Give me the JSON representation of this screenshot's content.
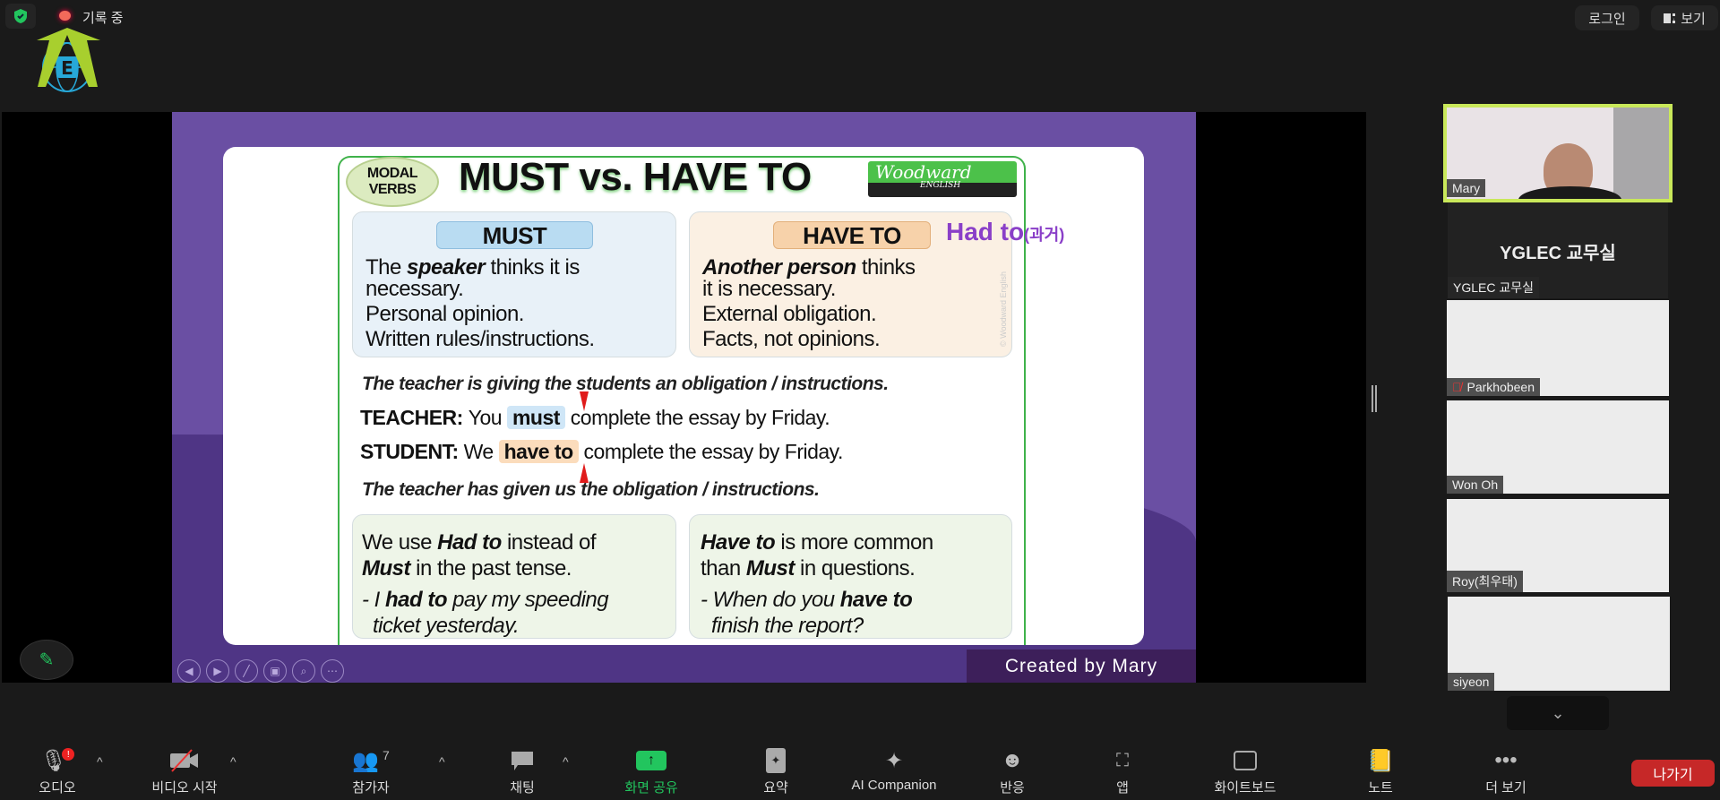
{
  "top": {
    "recording_label": "기록 중",
    "login_label": "로그인",
    "view_label": "보기"
  },
  "slide": {
    "badge": [
      "MODAL",
      "VERBS"
    ],
    "title": "MUST vs. HAVE TO",
    "logo": "Woodward ENGLISH",
    "must": {
      "label": "MUST",
      "lines": [
        [
          "The ",
          "speaker",
          " thinks it is"
        ],
        "necessary.",
        "Personal opinion.",
        "Written rules/instructions."
      ]
    },
    "have_to": {
      "label": "HAVE TO",
      "lines": [
        [
          "",
          "Another person",
          " thinks"
        ],
        "it is necessary.",
        "External obligation.",
        "Facts, not opinions."
      ]
    },
    "annotation": {
      "text": "Had to",
      "suffix": "(과거)",
      "color": "#8a3fc8"
    },
    "watermark": "© Woodward English",
    "sentence1": "The teacher is giving the students an obligation / instructions.",
    "teacher": {
      "speaker": "TEACHER:",
      "pre": "You",
      "verb": "must",
      "post": "complete the essay by Friday."
    },
    "student": {
      "speaker": "STUDENT:",
      "pre": "We",
      "verb": "have to",
      "post": "complete the essay by Friday."
    },
    "sentence2": "The teacher has given us the obligation / instructions.",
    "bottom_left": {
      "l1a": "We use ",
      "l1b": "Had to",
      "l1c": " instead of",
      "l2a": "Must",
      "l2b": " in the past tense.",
      "e1a": "- I ",
      "e1b": "had to",
      "e1c": " pay my speeding",
      "e2": "ticket yesterday."
    },
    "bottom_right": {
      "l1a": "Have to",
      "l1b": " is more common",
      "l2a": "than ",
      "l2b": "Must",
      "l2c": " in questions.",
      "e1a": "- When do you ",
      "e1b": "have to",
      "e2": "finish the report?"
    },
    "credit": "Created by Mary"
  },
  "participants": [
    {
      "name": "Mary",
      "video": true,
      "active_speaker": true
    },
    {
      "name": "YGLEC 교무실",
      "display": "YGLEC 교무실",
      "video": false
    },
    {
      "name": "Parkhobeen",
      "muted": true
    },
    {
      "name": "Won Oh"
    },
    {
      "name": "Roy(최우태)"
    },
    {
      "name": "siyeon"
    }
  ],
  "toolbar": {
    "audio": "오디오",
    "video": "비디오 시작",
    "participants": "참가자",
    "participant_count": "7",
    "chat": "채팅",
    "share": "화면 공유",
    "summary": "요약",
    "ai": "AI Companion",
    "reactions": "반응",
    "apps": "앱",
    "whiteboard": "화이트보드",
    "notes": "노트",
    "more": "더 보기",
    "leave": "나가기",
    "share_color": "#22c55e",
    "leave_color": "#c62828"
  }
}
